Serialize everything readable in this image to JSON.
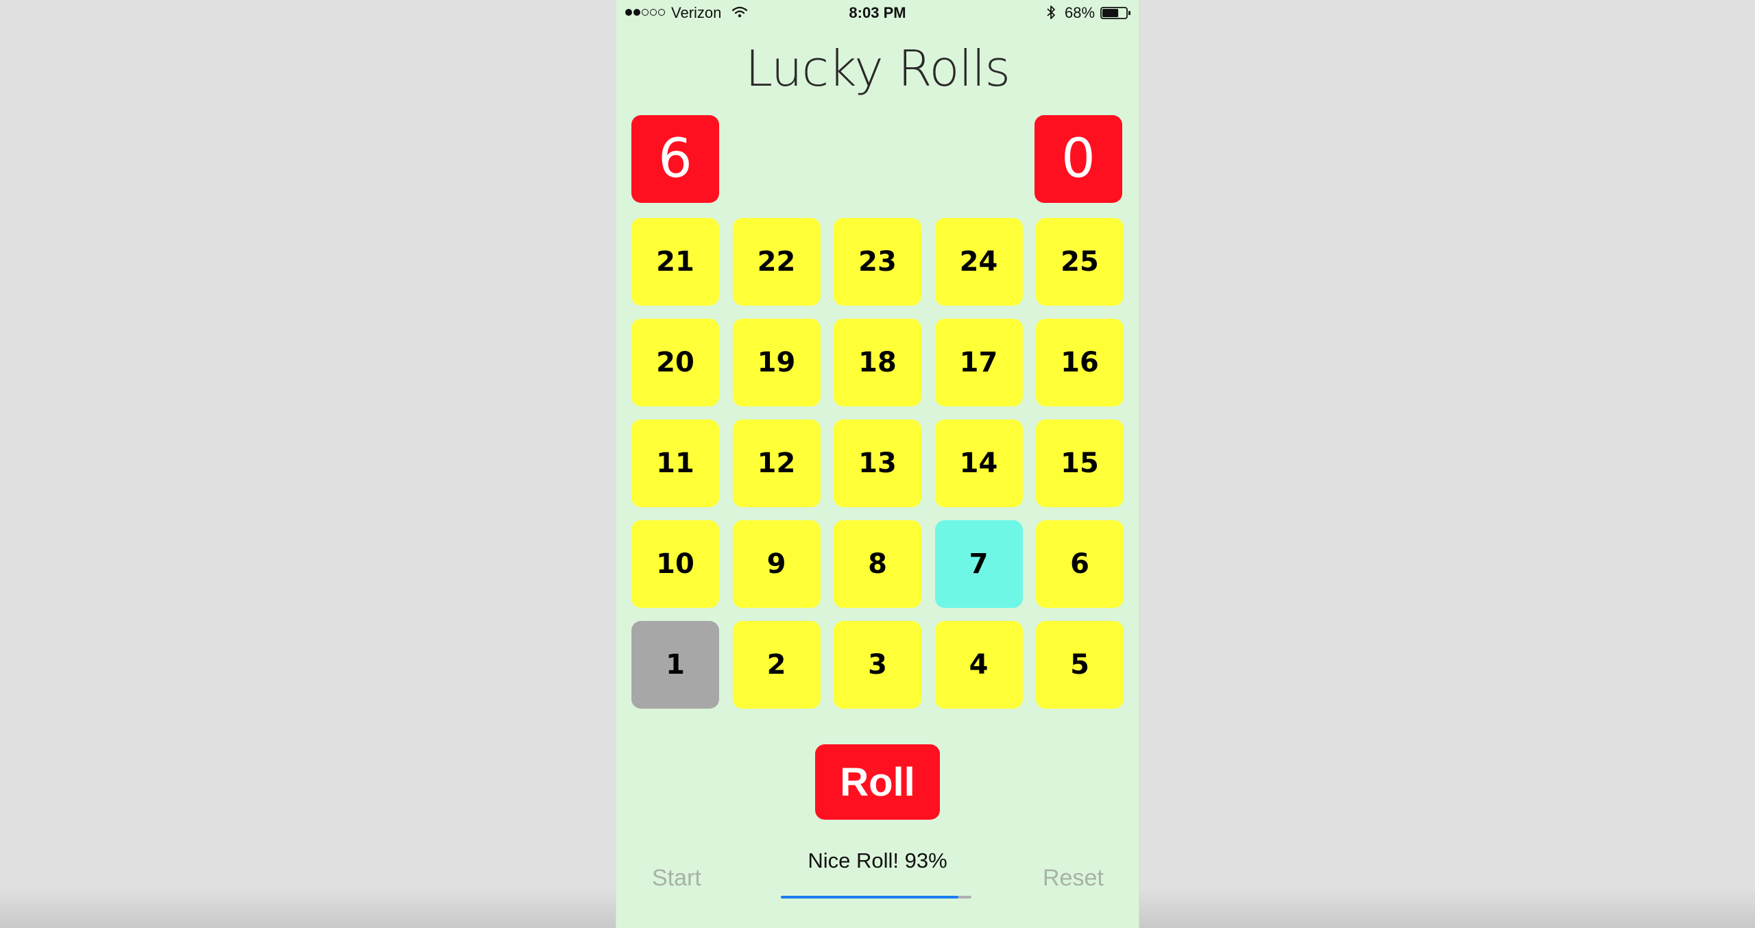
{
  "status_bar": {
    "signal_dots": 5,
    "signal_filled": 2,
    "carrier": "Verizon",
    "time": "8:03 PM",
    "battery_percent": "68%",
    "battery_level": 0.68,
    "icons": [
      "wifi-icon",
      "bluetooth-icon",
      "battery-icon"
    ]
  },
  "app": {
    "title": "Lucky Rolls"
  },
  "scores": {
    "left": "6",
    "right": "0",
    "color": "#ff1020"
  },
  "board": {
    "rows": [
      [
        "21",
        "22",
        "23",
        "24",
        "25"
      ],
      [
        "20",
        "19",
        "18",
        "17",
        "16"
      ],
      [
        "11",
        "12",
        "13",
        "14",
        "15"
      ],
      [
        "10",
        "9",
        "8",
        "7",
        "6"
      ],
      [
        "1",
        "2",
        "3",
        "4",
        "5"
      ]
    ],
    "current_tile": "7",
    "start_tile": "1",
    "colors": {
      "tile": "#ffff38",
      "current": "#6ff7e6",
      "start": "#a7a7a7"
    }
  },
  "controls": {
    "roll_label": "Roll",
    "start_label": "Start",
    "reset_label": "Reset"
  },
  "result": {
    "message": "Nice Roll! 93%",
    "progress": 0.93,
    "progress_color": "#1a7ef2"
  }
}
